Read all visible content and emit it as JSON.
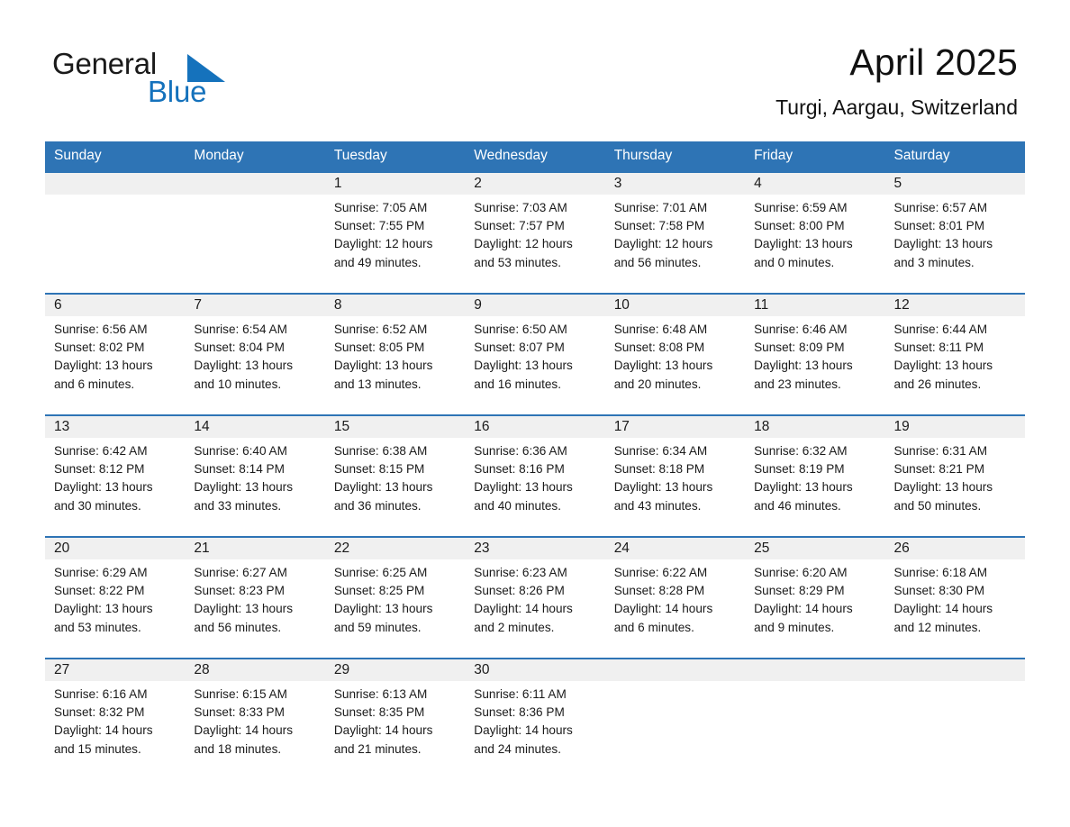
{
  "brand": {
    "name_part1": "General",
    "name_part2": "Blue",
    "triangle_icon": "triangle-icon",
    "accent_color": "#1572BC"
  },
  "header": {
    "title": "April 2025",
    "location": "Turgi, Aargau, Switzerland"
  },
  "theme": {
    "header_blue": "#2E74B5",
    "row_divider_blue": "#2E74B5",
    "daynum_band": "#F0F0F0",
    "text": "#1a1a1a",
    "page_background": "#ffffff"
  },
  "calendar": {
    "weekday_headers": [
      "Sunday",
      "Monday",
      "Tuesday",
      "Wednesday",
      "Thursday",
      "Friday",
      "Saturday"
    ],
    "weeks": [
      {
        "days": [
          {
            "num": "",
            "sunrise": "",
            "sunset": "",
            "daylight_l1": "",
            "daylight_l2": ""
          },
          {
            "num": "",
            "sunrise": "",
            "sunset": "",
            "daylight_l1": "",
            "daylight_l2": ""
          },
          {
            "num": "1",
            "sunrise": "Sunrise: 7:05 AM",
            "sunset": "Sunset: 7:55 PM",
            "daylight_l1": "Daylight: 12 hours",
            "daylight_l2": "and 49 minutes."
          },
          {
            "num": "2",
            "sunrise": "Sunrise: 7:03 AM",
            "sunset": "Sunset: 7:57 PM",
            "daylight_l1": "Daylight: 12 hours",
            "daylight_l2": "and 53 minutes."
          },
          {
            "num": "3",
            "sunrise": "Sunrise: 7:01 AM",
            "sunset": "Sunset: 7:58 PM",
            "daylight_l1": "Daylight: 12 hours",
            "daylight_l2": "and 56 minutes."
          },
          {
            "num": "4",
            "sunrise": "Sunrise: 6:59 AM",
            "sunset": "Sunset: 8:00 PM",
            "daylight_l1": "Daylight: 13 hours",
            "daylight_l2": "and 0 minutes."
          },
          {
            "num": "5",
            "sunrise": "Sunrise: 6:57 AM",
            "sunset": "Sunset: 8:01 PM",
            "daylight_l1": "Daylight: 13 hours",
            "daylight_l2": "and 3 minutes."
          }
        ]
      },
      {
        "days": [
          {
            "num": "6",
            "sunrise": "Sunrise: 6:56 AM",
            "sunset": "Sunset: 8:02 PM",
            "daylight_l1": "Daylight: 13 hours",
            "daylight_l2": "and 6 minutes."
          },
          {
            "num": "7",
            "sunrise": "Sunrise: 6:54 AM",
            "sunset": "Sunset: 8:04 PM",
            "daylight_l1": "Daylight: 13 hours",
            "daylight_l2": "and 10 minutes."
          },
          {
            "num": "8",
            "sunrise": "Sunrise: 6:52 AM",
            "sunset": "Sunset: 8:05 PM",
            "daylight_l1": "Daylight: 13 hours",
            "daylight_l2": "and 13 minutes."
          },
          {
            "num": "9",
            "sunrise": "Sunrise: 6:50 AM",
            "sunset": "Sunset: 8:07 PM",
            "daylight_l1": "Daylight: 13 hours",
            "daylight_l2": "and 16 minutes."
          },
          {
            "num": "10",
            "sunrise": "Sunrise: 6:48 AM",
            "sunset": "Sunset: 8:08 PM",
            "daylight_l1": "Daylight: 13 hours",
            "daylight_l2": "and 20 minutes."
          },
          {
            "num": "11",
            "sunrise": "Sunrise: 6:46 AM",
            "sunset": "Sunset: 8:09 PM",
            "daylight_l1": "Daylight: 13 hours",
            "daylight_l2": "and 23 minutes."
          },
          {
            "num": "12",
            "sunrise": "Sunrise: 6:44 AM",
            "sunset": "Sunset: 8:11 PM",
            "daylight_l1": "Daylight: 13 hours",
            "daylight_l2": "and 26 minutes."
          }
        ]
      },
      {
        "days": [
          {
            "num": "13",
            "sunrise": "Sunrise: 6:42 AM",
            "sunset": "Sunset: 8:12 PM",
            "daylight_l1": "Daylight: 13 hours",
            "daylight_l2": "and 30 minutes."
          },
          {
            "num": "14",
            "sunrise": "Sunrise: 6:40 AM",
            "sunset": "Sunset: 8:14 PM",
            "daylight_l1": "Daylight: 13 hours",
            "daylight_l2": "and 33 minutes."
          },
          {
            "num": "15",
            "sunrise": "Sunrise: 6:38 AM",
            "sunset": "Sunset: 8:15 PM",
            "daylight_l1": "Daylight: 13 hours",
            "daylight_l2": "and 36 minutes."
          },
          {
            "num": "16",
            "sunrise": "Sunrise: 6:36 AM",
            "sunset": "Sunset: 8:16 PM",
            "daylight_l1": "Daylight: 13 hours",
            "daylight_l2": "and 40 minutes."
          },
          {
            "num": "17",
            "sunrise": "Sunrise: 6:34 AM",
            "sunset": "Sunset: 8:18 PM",
            "daylight_l1": "Daylight: 13 hours",
            "daylight_l2": "and 43 minutes."
          },
          {
            "num": "18",
            "sunrise": "Sunrise: 6:32 AM",
            "sunset": "Sunset: 8:19 PM",
            "daylight_l1": "Daylight: 13 hours",
            "daylight_l2": "and 46 minutes."
          },
          {
            "num": "19",
            "sunrise": "Sunrise: 6:31 AM",
            "sunset": "Sunset: 8:21 PM",
            "daylight_l1": "Daylight: 13 hours",
            "daylight_l2": "and 50 minutes."
          }
        ]
      },
      {
        "days": [
          {
            "num": "20",
            "sunrise": "Sunrise: 6:29 AM",
            "sunset": "Sunset: 8:22 PM",
            "daylight_l1": "Daylight: 13 hours",
            "daylight_l2": "and 53 minutes."
          },
          {
            "num": "21",
            "sunrise": "Sunrise: 6:27 AM",
            "sunset": "Sunset: 8:23 PM",
            "daylight_l1": "Daylight: 13 hours",
            "daylight_l2": "and 56 minutes."
          },
          {
            "num": "22",
            "sunrise": "Sunrise: 6:25 AM",
            "sunset": "Sunset: 8:25 PM",
            "daylight_l1": "Daylight: 13 hours",
            "daylight_l2": "and 59 minutes."
          },
          {
            "num": "23",
            "sunrise": "Sunrise: 6:23 AM",
            "sunset": "Sunset: 8:26 PM",
            "daylight_l1": "Daylight: 14 hours",
            "daylight_l2": "and 2 minutes."
          },
          {
            "num": "24",
            "sunrise": "Sunrise: 6:22 AM",
            "sunset": "Sunset: 8:28 PM",
            "daylight_l1": "Daylight: 14 hours",
            "daylight_l2": "and 6 minutes."
          },
          {
            "num": "25",
            "sunrise": "Sunrise: 6:20 AM",
            "sunset": "Sunset: 8:29 PM",
            "daylight_l1": "Daylight: 14 hours",
            "daylight_l2": "and 9 minutes."
          },
          {
            "num": "26",
            "sunrise": "Sunrise: 6:18 AM",
            "sunset": "Sunset: 8:30 PM",
            "daylight_l1": "Daylight: 14 hours",
            "daylight_l2": "and 12 minutes."
          }
        ]
      },
      {
        "days": [
          {
            "num": "27",
            "sunrise": "Sunrise: 6:16 AM",
            "sunset": "Sunset: 8:32 PM",
            "daylight_l1": "Daylight: 14 hours",
            "daylight_l2": "and 15 minutes."
          },
          {
            "num": "28",
            "sunrise": "Sunrise: 6:15 AM",
            "sunset": "Sunset: 8:33 PM",
            "daylight_l1": "Daylight: 14 hours",
            "daylight_l2": "and 18 minutes."
          },
          {
            "num": "29",
            "sunrise": "Sunrise: 6:13 AM",
            "sunset": "Sunset: 8:35 PM",
            "daylight_l1": "Daylight: 14 hours",
            "daylight_l2": "and 21 minutes."
          },
          {
            "num": "30",
            "sunrise": "Sunrise: 6:11 AM",
            "sunset": "Sunset: 8:36 PM",
            "daylight_l1": "Daylight: 14 hours",
            "daylight_l2": "and 24 minutes."
          },
          {
            "num": "",
            "sunrise": "",
            "sunset": "",
            "daylight_l1": "",
            "daylight_l2": ""
          },
          {
            "num": "",
            "sunrise": "",
            "sunset": "",
            "daylight_l1": "",
            "daylight_l2": ""
          },
          {
            "num": "",
            "sunrise": "",
            "sunset": "",
            "daylight_l1": "",
            "daylight_l2": ""
          }
        ]
      }
    ]
  }
}
